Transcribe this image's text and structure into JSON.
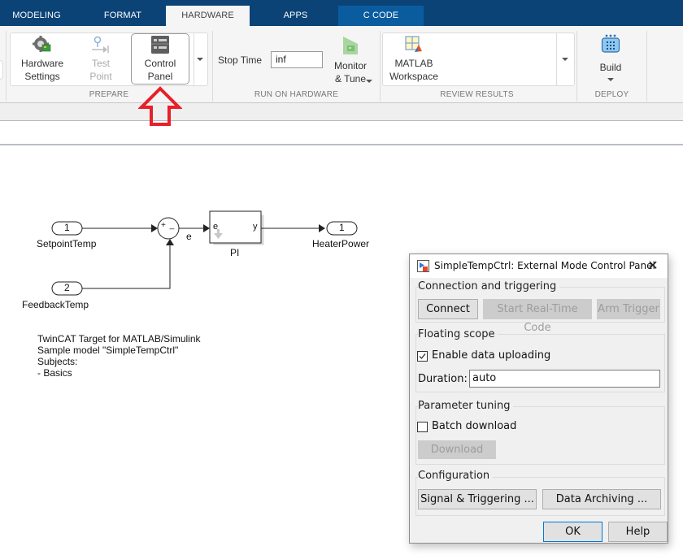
{
  "tabs": [
    {
      "label": "MODELING",
      "active": false
    },
    {
      "label": "FORMAT",
      "active": false
    },
    {
      "label": "HARDWARE",
      "active": true
    },
    {
      "label": "APPS",
      "active": false
    },
    {
      "label": "C CODE",
      "active": false
    }
  ],
  "ribbon": {
    "prepare": {
      "label": "PREPARE",
      "hardware_settings": {
        "line1": "Hardware",
        "line2": "Settings",
        "icon": "gear-chip-icon"
      },
      "test_point": {
        "line1": "Test",
        "line2": "Point",
        "icon": "test-point-icon",
        "enabled": false
      },
      "control_panel": {
        "line1": "Control",
        "line2": "Panel",
        "icon": "control-panel-icon"
      }
    },
    "run_on_hardware": {
      "label": "RUN ON HARDWARE",
      "stop_time_label": "Stop Time",
      "stop_time_value": "inf",
      "monitor_tune": {
        "line1": "Monitor",
        "line2": "& Tune",
        "icon": "monitor-tune-icon"
      }
    },
    "review_results": {
      "label": "REVIEW RESULTS",
      "matlab_workspace": {
        "line1": "MATLAB",
        "line2": "Workspace",
        "icon": "workspace-icon"
      }
    },
    "deploy": {
      "label": "DEPLOY",
      "build": {
        "line1": "Build",
        "icon": "build-icon"
      }
    }
  },
  "diagram": {
    "inports": [
      {
        "number": "1",
        "name": "SetpointTemp"
      },
      {
        "number": "2",
        "name": "FeedbackTemp"
      }
    ],
    "sum_block": {
      "signs": "+ _",
      "output_signal": "e"
    },
    "pi_block": {
      "name": "PI",
      "input_port": "e",
      "output_port": "y"
    },
    "outport": {
      "number": "1",
      "name": "HeaterPower"
    },
    "annotation": [
      "TwinCAT Target for MATLAB/Simulink",
      "Sample model \"SimpleTempCtrl\"",
      "Subjects:",
      "- Basics"
    ]
  },
  "dialog": {
    "title": "SimpleTempCtrl: External Mode Control Panel",
    "connection": {
      "legend": "Connection and triggering",
      "connect": "Connect",
      "start_rt": "Start Real-Time Code",
      "arm_trigger": "Arm Trigger"
    },
    "floating_scope": {
      "legend": "Floating scope",
      "enable_upload_label": "Enable data uploading",
      "enable_upload_checked": true,
      "duration_label": "Duration:",
      "duration_value": "auto"
    },
    "parameter_tuning": {
      "legend": "Parameter tuning",
      "batch_download_label": "Batch download",
      "batch_download_checked": false,
      "download": "Download"
    },
    "configuration": {
      "legend": "Configuration",
      "signal_triggering": "Signal & Triggering ...",
      "data_archiving": "Data Archiving ..."
    },
    "ok": "OK",
    "help": "Help"
  },
  "colors": {
    "tab_bar": "#0b4377",
    "tab_ccode": "#0a5c9f",
    "highlight_arrow": "#e8202a"
  }
}
